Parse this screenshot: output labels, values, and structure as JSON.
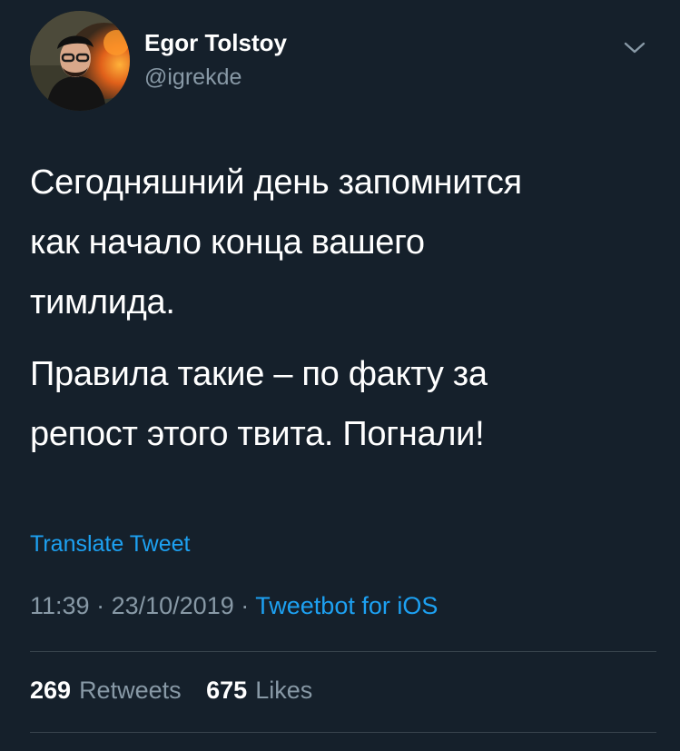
{
  "author": {
    "display_name": "Egor Tolstoy",
    "handle": "@igrekde"
  },
  "tweet": {
    "paragraphs": [
      "Сегодняшний день запомнится\nкак начало конца вашего\nтимлида.",
      "Правила такие – по факту за\nрепост этого твита. Погнали!"
    ],
    "translate_label": "Translate Tweet",
    "time": "11:39",
    "date": "23/10/2019",
    "separator": "·",
    "source": "Tweetbot for iOS"
  },
  "stats": {
    "retweets_count": "269",
    "retweets_label": "Retweets",
    "likes_count": "675",
    "likes_label": "Likes"
  },
  "icons": {
    "menu": "chevron-down-icon"
  },
  "colors": {
    "background": "#15202b",
    "text": "#ffffff",
    "secondary": "#8899a6",
    "link": "#1da1f2",
    "divider": "#38444d"
  }
}
